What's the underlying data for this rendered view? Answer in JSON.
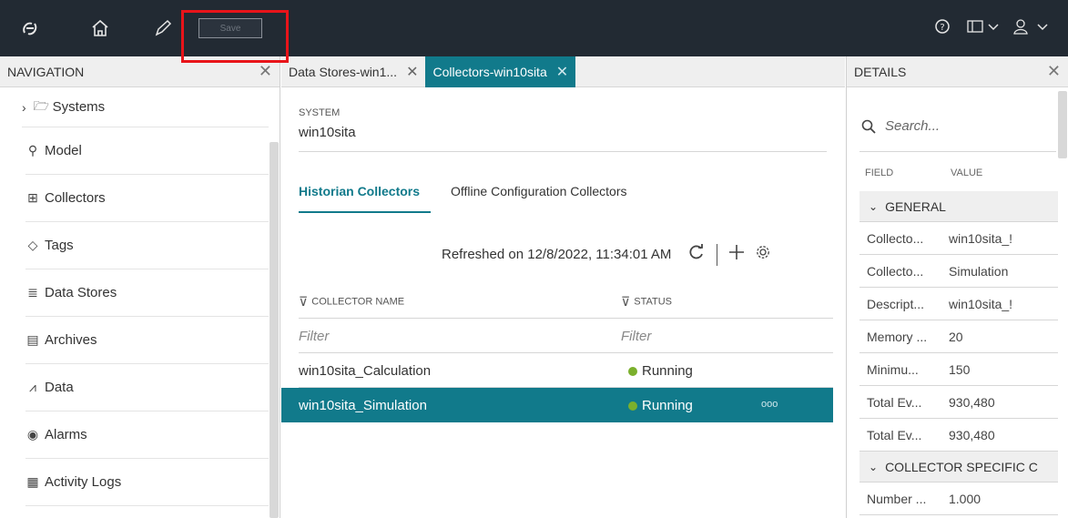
{
  "topbar": {
    "save_label": "Save",
    "icons": [
      "logo-icon",
      "home-icon",
      "pen-icon",
      "help-icon",
      "layout-icon",
      "user-icon"
    ]
  },
  "navigation": {
    "title": "NAVIGATION",
    "items": [
      {
        "label": "Systems",
        "icon": "folder-icon"
      },
      {
        "label": "Model",
        "icon": "model-icon"
      },
      {
        "label": "Collectors",
        "icon": "collectors-icon"
      },
      {
        "label": "Tags",
        "icon": "tag-icon"
      },
      {
        "label": "Data Stores",
        "icon": "database-icon"
      },
      {
        "label": "Archives",
        "icon": "archive-icon"
      },
      {
        "label": "Data",
        "icon": "chart-icon"
      },
      {
        "label": "Alarms",
        "icon": "alarm-icon"
      },
      {
        "label": "Activity Logs",
        "icon": "log-icon"
      }
    ]
  },
  "tabs": [
    {
      "label": "Data Stores-win1..."
    },
    {
      "label": "Collectors-win10sita"
    }
  ],
  "main": {
    "system_label": "SYSTEM",
    "system_value": "win10sita",
    "subtabs": [
      "Historian Collectors",
      "Offline Configuration Collectors"
    ],
    "refreshed": "Refreshed on 12/8/2022, 11:34:01 AM",
    "table": {
      "headers": [
        "COLLECTOR NAME",
        "STATUS"
      ],
      "filter_placeholder": "Filter",
      "rows": [
        {
          "name": "win10sita_Calculation",
          "status": "Running"
        },
        {
          "name": "win10sita_Simulation",
          "status": "Running"
        }
      ],
      "more_label": "ooo"
    }
  },
  "details": {
    "title": "DETAILS",
    "search_placeholder": "Search...",
    "field_header": "FIELD",
    "value_header": "VALUE",
    "group_general": "GENERAL",
    "rows": [
      {
        "field": "Collecto...",
        "value": "win10sita_!"
      },
      {
        "field": "Collecto...",
        "value": "Simulation"
      },
      {
        "field": "Descript...",
        "value": "win10sita_!"
      },
      {
        "field": "Memory ...",
        "value": "20"
      },
      {
        "field": "Minimu...",
        "value": "150"
      },
      {
        "field": "Total Ev...",
        "value": "930,480"
      },
      {
        "field": "Total Ev...",
        "value": "930,480"
      }
    ],
    "group_specific": "COLLECTOR SPECIFIC C",
    "specific_rows": [
      {
        "field": "Number ...",
        "value": "1.000"
      }
    ]
  },
  "colors": {
    "accent": "#117a8b",
    "topbar": "#222a33",
    "running": "#7bb02d",
    "highlight": "#e8141a"
  }
}
